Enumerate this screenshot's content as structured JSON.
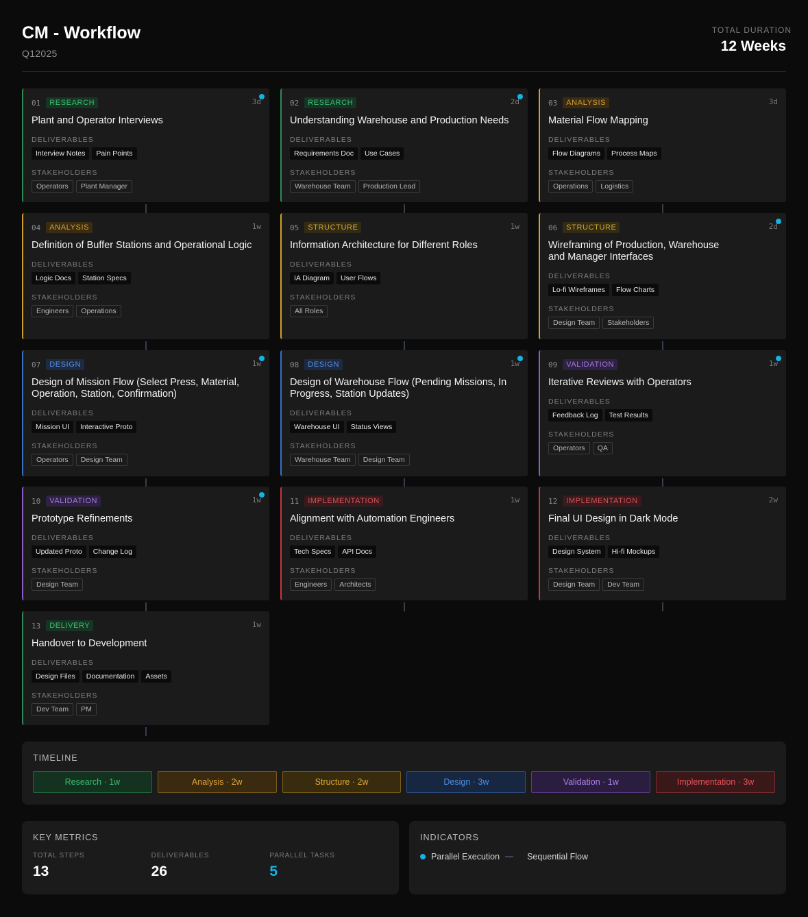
{
  "header": {
    "title": "CM - Workflow",
    "subtitle": "Q12025",
    "duration_label": "TOTAL DURATION",
    "duration_value": "12 Weeks"
  },
  "labels": {
    "deliverables": "DELIVERABLES",
    "stakeholders": "STAKEHOLDERS"
  },
  "steps": [
    {
      "num": "01",
      "tag": "RESEARCH",
      "dur": "3d",
      "parallel": true,
      "title": "Plant and Operator Interviews",
      "deliverables": [
        "Interview Notes",
        "Pain Points"
      ],
      "stakeholders": [
        "Operators",
        "Plant Manager"
      ]
    },
    {
      "num": "02",
      "tag": "RESEARCH",
      "dur": "2d",
      "parallel": true,
      "title": "Understanding Warehouse and Production Needs",
      "deliverables": [
        "Requirements Doc",
        "Use Cases"
      ],
      "stakeholders": [
        "Warehouse Team",
        "Production Lead"
      ]
    },
    {
      "num": "03",
      "tag": "ANALYSIS",
      "dur": "3d",
      "parallel": false,
      "title": "Material Flow Mapping",
      "deliverables": [
        "Flow Diagrams",
        "Process Maps"
      ],
      "stakeholders": [
        "Operations",
        "Logistics"
      ]
    },
    {
      "num": "04",
      "tag": "ANALYSIS",
      "dur": "1w",
      "parallel": false,
      "title": "Definition of Buffer Stations and Operational Logic",
      "deliverables": [
        "Logic Docs",
        "Station Specs"
      ],
      "stakeholders": [
        "Engineers",
        "Operations"
      ]
    },
    {
      "num": "05",
      "tag": "STRUCTURE",
      "dur": "1w",
      "parallel": false,
      "title": "Information Architecture for Different Roles",
      "deliverables": [
        "IA Diagram",
        "User Flows"
      ],
      "stakeholders": [
        "All Roles"
      ]
    },
    {
      "num": "06",
      "tag": "STRUCTURE",
      "dur": "2d",
      "parallel": true,
      "title": "Wireframing of Production, Warehouse and Manager Interfaces",
      "deliverables": [
        "Lo-fi Wireframes",
        "Flow Charts"
      ],
      "stakeholders": [
        "Design Team",
        "Stakeholders"
      ]
    },
    {
      "num": "07",
      "tag": "DESIGN",
      "dur": "1w",
      "parallel": true,
      "title": "Design of Mission Flow (Select Press, Material, Operation, Station, Confirmation)",
      "deliverables": [
        "Mission UI",
        "Interactive Proto"
      ],
      "stakeholders": [
        "Operators",
        "Design Team"
      ]
    },
    {
      "num": "08",
      "tag": "DESIGN",
      "dur": "1w",
      "parallel": true,
      "title": "Design of Warehouse Flow (Pending Missions, In Progress, Station Updates)",
      "deliverables": [
        "Warehouse UI",
        "Status Views"
      ],
      "stakeholders": [
        "Warehouse Team",
        "Design Team"
      ]
    },
    {
      "num": "09",
      "tag": "VALIDATION",
      "dur": "1w",
      "parallel": true,
      "title": "Iterative Reviews with Operators",
      "deliverables": [
        "Feedback Log",
        "Test Results"
      ],
      "stakeholders": [
        "Operators",
        "QA"
      ]
    },
    {
      "num": "10",
      "tag": "VALIDATION",
      "dur": "1w",
      "parallel": true,
      "title": "Prototype Refinements",
      "deliverables": [
        "Updated Proto",
        "Change Log"
      ],
      "stakeholders": [
        "Design Team"
      ]
    },
    {
      "num": "11",
      "tag": "IMPLEMENTATION",
      "dur": "1w",
      "parallel": false,
      "title": "Alignment with Automation Engineers",
      "deliverables": [
        "Tech Specs",
        "API Docs"
      ],
      "stakeholders": [
        "Engineers",
        "Architects"
      ]
    },
    {
      "num": "12",
      "tag": "IMPLEMENTATION",
      "dur": "2w",
      "parallel": false,
      "title": "Final UI Design in Dark Mode",
      "deliverables": [
        "Design System",
        "Hi-fi Mockups"
      ],
      "stakeholders": [
        "Design Team",
        "Dev Team"
      ]
    },
    {
      "num": "13",
      "tag": "DELIVERY",
      "dur": "1w",
      "parallel": false,
      "title": "Handover to Development",
      "deliverables": [
        "Design Files",
        "Documentation",
        "Assets"
      ],
      "stakeholders": [
        "Dev Team",
        "PM"
      ]
    }
  ],
  "timeline": {
    "label": "TIMELINE",
    "phases": [
      "Research · 1w",
      "Analysis · 2w",
      "Structure · 2w",
      "Design · 3w",
      "Validation · 1w",
      "Implementation · 3w"
    ]
  },
  "metrics": {
    "label": "KEY METRICS",
    "items": [
      {
        "label": "TOTAL STEPS",
        "value": "13"
      },
      {
        "label": "DELIVERABLES",
        "value": "26"
      },
      {
        "label": "PARALLEL TASKS",
        "value": "5"
      }
    ]
  },
  "indicators": {
    "label": "INDICATORS",
    "parallel": "Parallel Execution",
    "sequential": "Sequential Flow"
  },
  "colors": {
    "accent": "#14b3e0",
    "research": "#2f8a55",
    "analysis": "#d39b2e",
    "structure": "#cfa22c",
    "design": "#3b6fc4",
    "validation": "#8b5bc6",
    "implementation": "#c0393e",
    "delivery": "#2f8a55"
  }
}
